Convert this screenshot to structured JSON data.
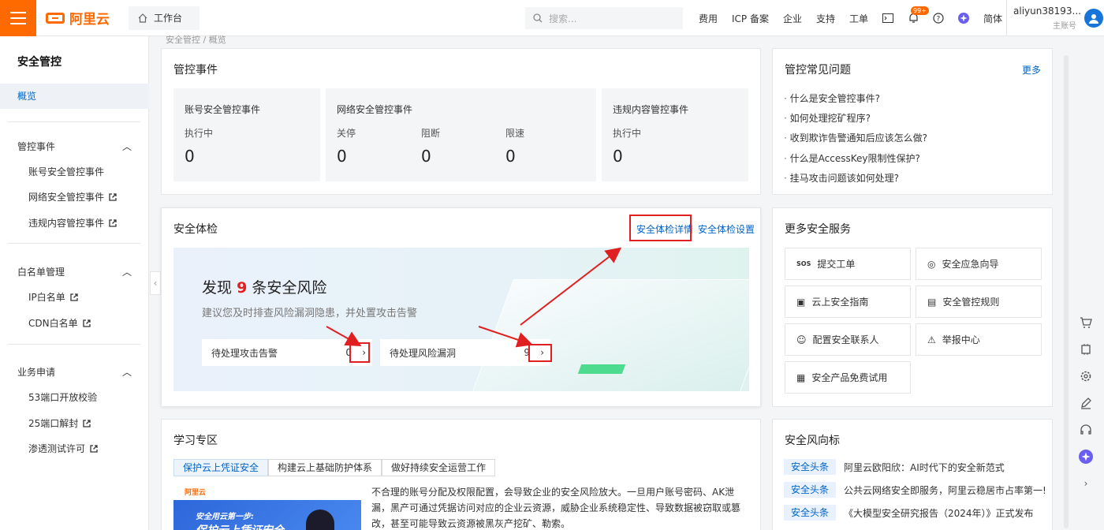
{
  "topbar": {
    "brand": "阿里云",
    "workbench": "工作台",
    "search_placeholder": "搜索...",
    "links": [
      "费用",
      "ICP 备案",
      "企业",
      "支持",
      "工单"
    ],
    "notification_count": "99+",
    "language": "简体",
    "user_name": "aliyun38193...",
    "user_role": "主账号"
  },
  "sidebar": {
    "title": "安全管控",
    "active": "概览",
    "groups": [
      {
        "label": "管控事件",
        "items": [
          "账号安全管控事件",
          "网络安全管控事件",
          "违规内容管控事件"
        ]
      },
      {
        "label": "白名单管理",
        "items": [
          "IP白名单",
          "CDN白名单"
        ]
      },
      {
        "label": "业务申请",
        "items": [
          "53端口开放校验",
          "25端口解封",
          "渗透测试许可"
        ]
      }
    ]
  },
  "breadcrumb": "安全管控  /  概览",
  "events": {
    "title": "管控事件",
    "account": {
      "title": "账号安全管控事件",
      "label": "执行中",
      "value": "0"
    },
    "network": {
      "title": "网络安全管控事件",
      "labels": [
        "关停",
        "阻断",
        "限速"
      ],
      "values": [
        "0",
        "0",
        "0"
      ]
    },
    "content": {
      "title": "违规内容管控事件",
      "label": "执行中",
      "value": "0"
    }
  },
  "faq": {
    "title": "管控常见问题",
    "more": "更多",
    "items": [
      "什么是安全管控事件?",
      "如何处理挖矿程序?",
      "收到欺诈告警通知后应该怎么做?",
      "什么是AccessKey限制性保护?",
      "挂马攻击问题该如何处理?"
    ]
  },
  "check": {
    "title": "安全体检",
    "detail_link": "安全体检详情",
    "settings_link": "安全体检设置",
    "headline_prefix": "发现",
    "risk_count": "9",
    "headline_suffix": "条安全风险",
    "subtitle": "建议您及时排查风险漏洞隐患，并处置攻击告警",
    "pending_attacks": {
      "label": "待处理攻击告警",
      "value": "0"
    },
    "pending_vulns": {
      "label": "待处理风险漏洞",
      "value": "9"
    }
  },
  "services": {
    "title": "更多安全服务",
    "items": [
      "提交工单",
      "安全应急向导",
      "云上安全指南",
      "安全管控规则",
      "配置安全联系人",
      "举报中心",
      "安全产品免费试用"
    ]
  },
  "learning": {
    "title": "学习专区",
    "tabs": [
      "保护云上凭证安全",
      "构建云上基础防护体系",
      "做好持续安全运营工作"
    ],
    "img_brand": "阿里云",
    "img_line1": "安全用云第一步:",
    "img_line2": "保护云上凭证安全",
    "text": "不合理的账号分配及权限配置，会导致企业的安全风险放大。一旦用户账号密码、AK泄漏，黑产可通过凭据访问对应的企业云资源，威胁企业系统稳定性、导致数据被窃取或篡改，甚至可能导致云资源被黑灰产挖矿、勒索。"
  },
  "news": {
    "title": "安全风向标",
    "items": [
      {
        "tag": "安全头条",
        "text": "阿里云欧阳欣：AI时代下的安全新范式"
      },
      {
        "tag": "安全头条",
        "text": "公共云网络安全即服务，阿里云稳居市占率第一!"
      },
      {
        "tag": "安全头条",
        "text": "《大模型安全研究报告（2024年）》正式发布"
      }
    ]
  },
  "colors": {
    "accent": "#ff6a00",
    "link": "#0064c8",
    "risk": "#e02020"
  }
}
